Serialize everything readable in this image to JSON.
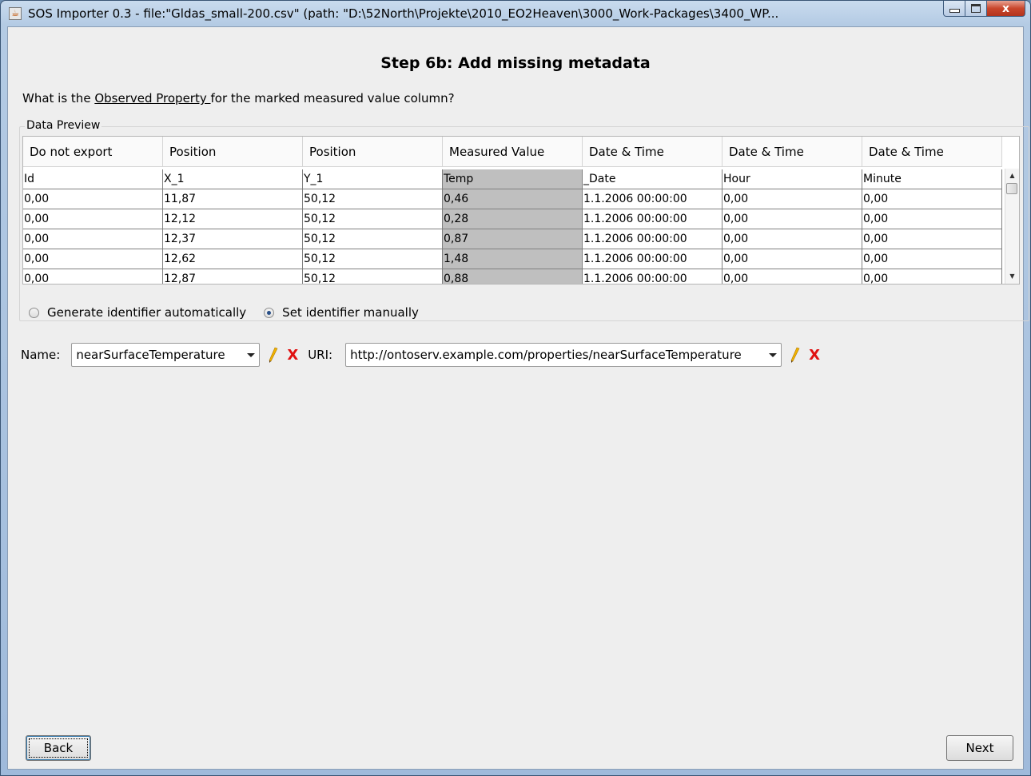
{
  "window": {
    "title": "SOS Importer 0.3 - file:\"Gldas_small-200.csv\" (path: \"D:\\52North\\Projekte\\2010_EO2Heaven\\3000_Work-Packages\\3400_WP...",
    "close_glyph": "x"
  },
  "step_title": "Step 6b: Add missing metadata",
  "question": {
    "prefix": "What is the ",
    "link": "Observed Property ",
    "suffix": "for the marked measured value column?"
  },
  "data_preview": {
    "legend": "Data Preview",
    "headers": [
      "Do not export",
      "Position",
      "Position",
      "Measured Value",
      "Date & Time",
      "Date & Time",
      "Date & Time"
    ],
    "rows": [
      [
        "Id",
        "X_1",
        "Y_1",
        "Temp",
        "_Date",
        "Hour",
        "Minute"
      ],
      [
        "0,00",
        "11,87",
        "50,12",
        "0,46",
        "1.1.2006 00:00:00",
        "0,00",
        "0,00"
      ],
      [
        "0,00",
        "12,12",
        "50,12",
        "0,28",
        "1.1.2006 00:00:00",
        "0,00",
        "0,00"
      ],
      [
        "0,00",
        "12,37",
        "50,12",
        "0,87",
        "1.1.2006 00:00:00",
        "0,00",
        "0,00"
      ],
      [
        "0,00",
        "12,62",
        "50,12",
        "1,48",
        "1.1.2006 00:00:00",
        "0,00",
        "0,00"
      ],
      [
        "0,00",
        "12,87",
        "50,12",
        "0,88",
        "1.1.2006 00:00:00",
        "0,00",
        "0,00"
      ]
    ],
    "highlighted_column": 3,
    "highlight_color": "#bfbfbf"
  },
  "identifier": {
    "auto_label": "Generate identifier automatically",
    "manual_label": "Set identifier manually",
    "selected": "manual"
  },
  "name_field": {
    "label": "Name:",
    "value": "nearSurfaceTemperature"
  },
  "uri_field": {
    "label": "URI:",
    "value": "http://ontoserv.example.com/properties/nearSurfaceTemperature"
  },
  "icons": {
    "edit": "pencil-icon",
    "delete": "x-icon",
    "delete_glyph": "X",
    "delete_color": "#e01010"
  },
  "buttons": {
    "back": "Back",
    "next": "Next"
  }
}
